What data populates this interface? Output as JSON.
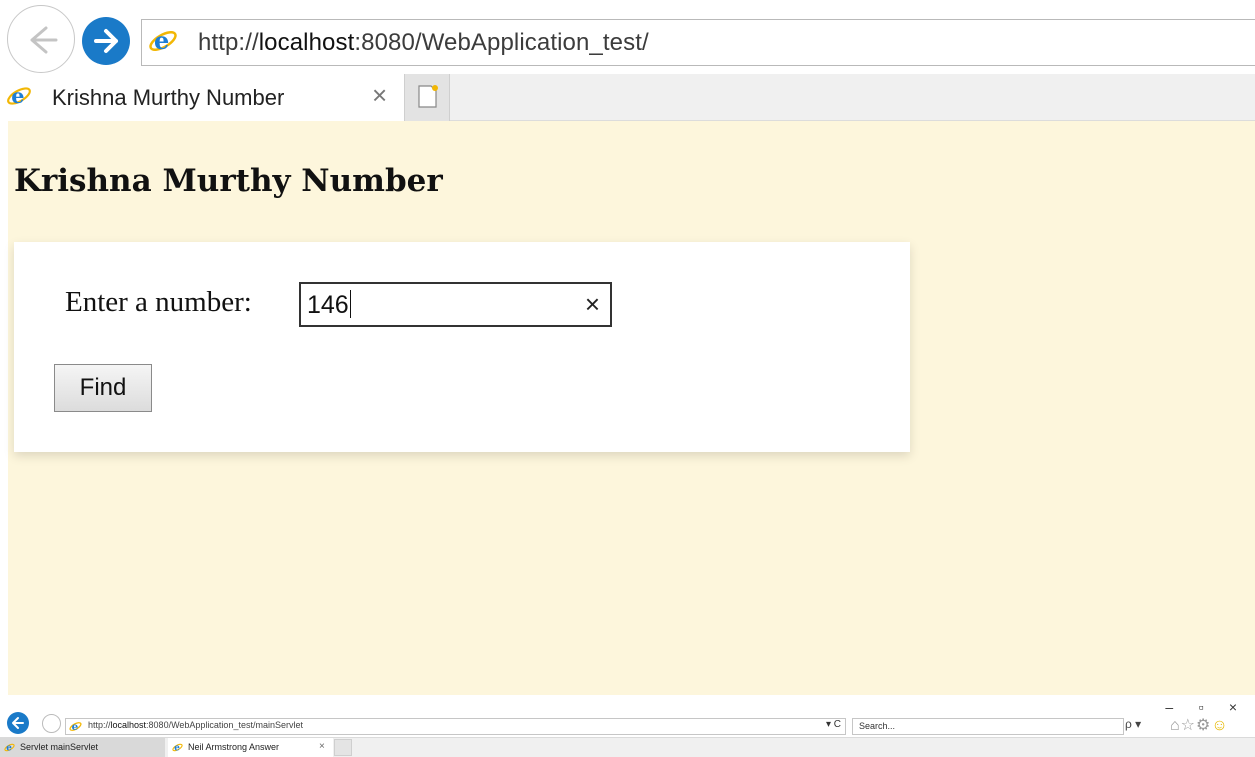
{
  "browser": {
    "address_url_prefix": "http://",
    "address_url_host": "localhost",
    "address_url_rest": ":8080/WebApplication_test/",
    "tab_title": "Krishna Murthy Number",
    "tab_close_label": "×"
  },
  "page": {
    "background_color": "#fdf6dc",
    "heading": "Krishna Murthy Number",
    "form": {
      "label": "Enter a number:",
      "input_value": "146",
      "clear_label": "×",
      "find_button_label": "Find"
    }
  },
  "bottom_window": {
    "window_controls": [
      "–",
      "▫",
      "×"
    ],
    "address_url_prefix": "http://",
    "address_url_host": "localhost",
    "address_url_rest": ":8080/WebApplication_test/mainServlet",
    "address_tools": "▾ C",
    "search_placeholder": "Search...",
    "search_tools": "ρ ▾",
    "tabs": [
      {
        "label": "Servlet mainServlet"
      },
      {
        "label": "Neil Armstrong Answer",
        "close_label": "×"
      }
    ]
  },
  "icons": {
    "back": "back-arrow-icon",
    "forward": "forward-arrow-icon",
    "ie_logo": "ie-logo-icon",
    "new_tab": "new-tab-icon",
    "home": "home-icon",
    "favorites": "star-icon",
    "settings": "gear-icon",
    "feedback": "smiley-icon"
  },
  "colors": {
    "accent_blue": "#1a7ac8",
    "page_bg": "#fdf6dc"
  }
}
